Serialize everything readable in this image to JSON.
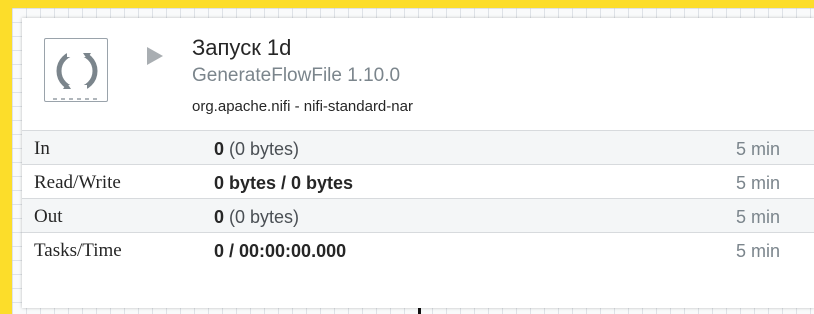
{
  "processor": {
    "name": "Запуск 1d",
    "type": "GenerateFlowFile 1.10.0",
    "bundle": "org.apache.nifi - nifi-standard-nar",
    "run_state": "stopped"
  },
  "stats": [
    {
      "label": "In",
      "value_bold": "0",
      "value_sub": "(0 bytes)",
      "window": "5 min"
    },
    {
      "label": "Read/Write",
      "value_bold": "0 bytes / 0 bytes",
      "value_sub": "",
      "window": "5 min"
    },
    {
      "label": "Out",
      "value_bold": "0",
      "value_sub": "(0 bytes)",
      "window": "5 min"
    },
    {
      "label": "Tasks/Time",
      "value_bold": "0 / 00:00:00.000",
      "value_sub": "",
      "window": "5 min"
    }
  ],
  "colors": {
    "page_background": "#fcdd2a",
    "label_text": "#262626",
    "muted_text": "#7b858c"
  },
  "icons": {
    "processor": "processor-icon",
    "run_state": "play-icon"
  }
}
